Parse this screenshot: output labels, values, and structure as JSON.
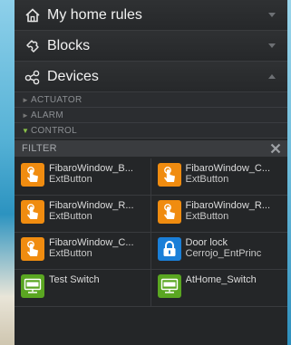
{
  "sections": {
    "rules": {
      "label": "My home rules",
      "icon": "home-icon"
    },
    "blocks": {
      "label": "Blocks",
      "icon": "puzzle-icon"
    },
    "devices": {
      "label": "Devices",
      "icon": "share-icon"
    }
  },
  "categories": [
    {
      "label": "ACTUATOR",
      "expanded": false
    },
    {
      "label": "ALARM",
      "expanded": false
    },
    {
      "label": "CONTROL",
      "expanded": true
    }
  ],
  "filter": {
    "label": "FILTER"
  },
  "devices": [
    {
      "name": "FibaroWindow_B...",
      "type": "ExtButton",
      "icon": "touch-icon",
      "color": "#f08c10"
    },
    {
      "name": "FibaroWindow_C...",
      "type": "ExtButton",
      "icon": "touch-icon",
      "color": "#f08c10"
    },
    {
      "name": "FibaroWindow_R...",
      "type": "ExtButton",
      "icon": "touch-icon",
      "color": "#f08c10"
    },
    {
      "name": "FibaroWindow_R...",
      "type": "ExtButton",
      "icon": "touch-icon",
      "color": "#f08c10"
    },
    {
      "name": "FibaroWindow_C...",
      "type": "ExtButton",
      "icon": "touch-icon",
      "color": "#f08c10"
    },
    {
      "name": "Door lock",
      "type": "Cerrojo_EntPrinc",
      "icon": "lock-icon",
      "color": "#1a7fd8"
    },
    {
      "name": "Test Switch",
      "type": "",
      "icon": "http-icon",
      "color": "#5aa621"
    },
    {
      "name": "AtHome_Switch",
      "type": "",
      "icon": "http-icon",
      "color": "#5aa621"
    }
  ]
}
